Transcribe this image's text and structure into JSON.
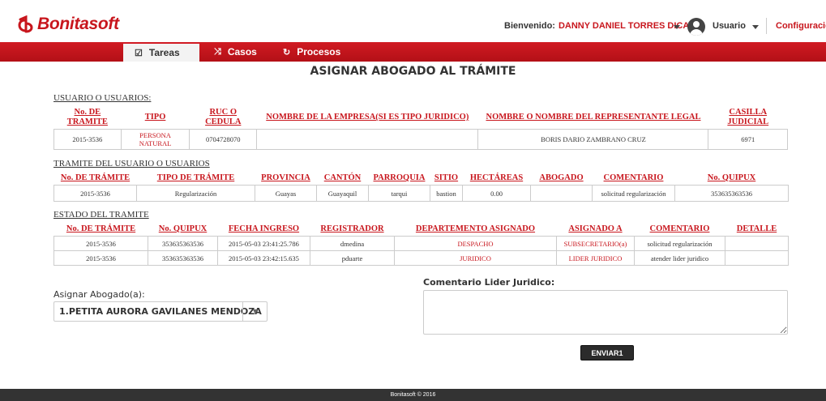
{
  "brand": {
    "name": "Bonitasoft",
    "color": "#c8161d"
  },
  "header": {
    "welcome_label": "Bienvenido:",
    "user_full_name": "DANNY DANIEL TORRES DICAO",
    "user_label": "Usuario",
    "config_label": "Configuración"
  },
  "nav": {
    "tasks": {
      "label": "Tareas",
      "icon": "checkbox-edit-icon"
    },
    "cases": {
      "label": "Casos",
      "icon": "shuffle-icon"
    },
    "processes": {
      "label": "Procesos",
      "icon": "cycle-icon"
    }
  },
  "page": {
    "title": "ASIGNAR ABOGADO AL TRÁMITE"
  },
  "users": {
    "section_title": "USUARIO O USUARIOS:",
    "headers": [
      "No. DE TRAMITE",
      "TIPO",
      "RUC O CEDULA",
      "NOMBRE DE LA EMPRESA(SI ES TIPO JURIDICO)",
      "NOMBRE O NOMBRE DEL REPRESENTANTE LEGAL",
      "CASILLA JUDICIAL"
    ],
    "rows": [
      [
        "2015-3536",
        "PERSONA NATURAL",
        "0704728070",
        "",
        "BORIS DARIO ZAMBRANO CRUZ",
        "6971"
      ]
    ]
  },
  "procedure": {
    "section_title": "TRAMITE DEL USUARIO O USUARIOS",
    "headers": [
      "No. DE TRÁMITE",
      "TIPO DE TRÁMITE",
      "PROVINCIA",
      "CANTÓN",
      "PARROQUIA",
      "SITIO",
      "HECTÁREAS",
      "ABOGADO",
      "COMENTARIO",
      "No. QUIPUX"
    ],
    "rows": [
      [
        "2015-3536",
        "Regularización",
        "Guayas",
        "Guayaquil",
        "tarqui",
        "bastion",
        "0.00",
        "",
        "solicitud regularización",
        "353635363536"
      ]
    ]
  },
  "status": {
    "section_title": "ESTADO DEL TRAMITE",
    "headers": [
      "No. DE TRÁMITE",
      "No. QUIPUX",
      "FECHA INGRESO",
      "REGISTRADOR",
      "DEPARTEMENTO ASIGNADO",
      "ASIGNADO A",
      "COMENTARIO",
      "DETALLE"
    ],
    "rows": [
      [
        "2015-3536",
        "353635363536",
        "2015-05-03 23:41:25.786",
        "dmedina",
        "DESPACHO",
        "SUBSECRETARIO(a)",
        "solicitud regularización",
        ""
      ],
      [
        "2015-3536",
        "353635363536",
        "2015-05-03 23:42:15.635",
        "pduarte",
        "JURIDICO",
        "LIDER JURIDICO",
        "atender lider juridico",
        ""
      ]
    ]
  },
  "form": {
    "assign_label": "Asignar Abogado(a):",
    "assign_value": "1.PETITA AURORA GAVILANES MENDOZA",
    "comment_label": "Comentario Lider Juridico:",
    "comment_value": "",
    "send_label": "ENVIAR1"
  },
  "footer": {
    "text": "Bonitasoft © 2016"
  }
}
